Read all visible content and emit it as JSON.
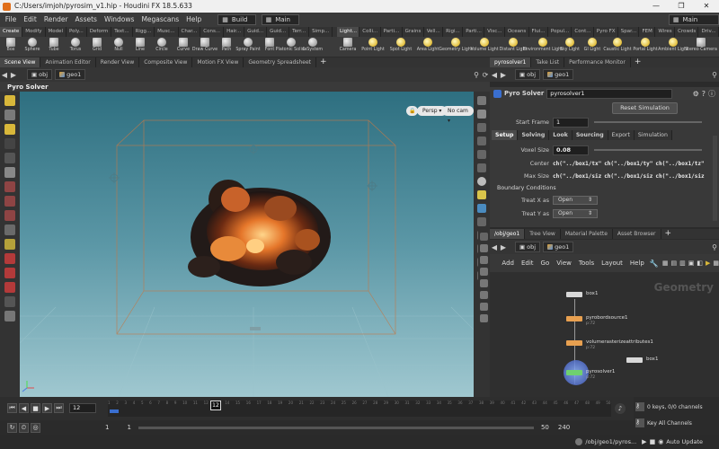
{
  "window": {
    "title": "C:/Users/imjoh/pyrosim_v1.hip - Houdini FX 18.5.633",
    "minimize": "—",
    "maximize": "❐",
    "close": "✕"
  },
  "menu": [
    "File",
    "Edit",
    "Render",
    "Assets",
    "Windows",
    "Megascans",
    "Help"
  ],
  "desktops": {
    "build": "Build",
    "main_left": "Main",
    "main_right": "Main"
  },
  "shelf_tabs_left": [
    "Create",
    "Modify",
    "Model",
    "Poly...",
    "Deform",
    "Text...",
    "Rigg...",
    "Musc...",
    "Char...",
    "Cons...",
    "Hair...",
    "Guid...",
    "Guid...",
    "Terr...",
    "Simp..."
  ],
  "shelf_tabs_right": [
    "Light...",
    "Colli...",
    "Parti...",
    "Grains",
    "Vell...",
    "Rigi...",
    "Parti...",
    "Visc...",
    "Oceans",
    "Flui...",
    "Popul...",
    "Cont...",
    "Pyro FX",
    "Spar...",
    "FEM",
    "Wires",
    "Crowds",
    "Driv..."
  ],
  "shelf_tools_left": [
    "Box",
    "Sphere",
    "Tube",
    "Torus",
    "Grid",
    "Null",
    "Line",
    "Circle",
    "Curve",
    "Draw Curve",
    "Path",
    "Spray Paint",
    "Font",
    "Platonic Solids",
    "L-System"
  ],
  "shelf_tools_right": [
    "Camera",
    "Point Light",
    "Spot Light",
    "Area Light",
    "Geometry Light",
    "Volume Light",
    "Distant Light",
    "Environment Light",
    "Sky Light",
    "GI Light",
    "Caustic Light",
    "Portal Light",
    "Ambient Light",
    "Stereo Camera"
  ],
  "pane_tabs_left": [
    "Scene View",
    "Animation Editor",
    "Render View",
    "Composite View",
    "Motion FX View",
    "Geometry Spreadsheet"
  ],
  "pane_tabs_right": [
    "pyrosolver1",
    "Take List",
    "Performance Monitor"
  ],
  "path": {
    "obj": "obj",
    "geo": "geo1"
  },
  "viewport": {
    "title": "Pyro Solver",
    "persp": "Persp ▾",
    "cam": "No cam ▾"
  },
  "params": {
    "node_type": "Pyro Solver",
    "node_name": "pyrosolver1",
    "reset_button": "Reset Simulation",
    "start_frame_label": "Start Frame",
    "start_frame": "1",
    "tabs": [
      "Setup",
      "Solving",
      "Look",
      "Sourcing",
      "Export",
      "Simulation"
    ],
    "voxel_size_label": "Voxel Size",
    "voxel_size": "0.08",
    "center_label": "Center",
    "center_values": [
      "ch(\"../box1/tx\"",
      "ch(\"../box1/ty\"",
      "ch(\"../box1/tz\""
    ],
    "max_size_label": "Max Size",
    "max_size_values": [
      "ch(\"../box1/siz",
      "ch(\"../box1/siz",
      "ch(\"../box1/siz"
    ],
    "boundary_heading": "Boundary Conditions",
    "treat_x_label": "Treat X as",
    "treat_x": "Open",
    "treat_y_label": "Treat Y as",
    "treat_y": "Open"
  },
  "network": {
    "tabs": [
      "/obj/geo1",
      "Tree View",
      "Material Palette",
      "Asset Browser"
    ],
    "menu": [
      "Add",
      "Edit",
      "Go",
      "View",
      "Tools",
      "Layout",
      "Help"
    ],
    "context_label": "Geometry",
    "nodes": [
      {
        "name": "box1",
        "sub": ""
      },
      {
        "name": "pyrobordsource1",
        "sub": "p:72"
      },
      {
        "name": "volumerasterizeattributes1",
        "sub": "p:72"
      },
      {
        "name": "pyrosolver1",
        "sub": "p:72"
      },
      {
        "name": "box1",
        "sub": ""
      }
    ]
  },
  "timeline": {
    "current_frame": "12",
    "ticks": [
      "1",
      "2",
      "3",
      "4",
      "5",
      "6",
      "7",
      "8",
      "9",
      "10",
      "11",
      "12",
      "13",
      "14",
      "15",
      "16",
      "17",
      "18",
      "19",
      "20",
      "21",
      "22",
      "23",
      "24",
      "25",
      "26",
      "27",
      "28",
      "29",
      "30",
      "31",
      "32",
      "33",
      "34",
      "35",
      "36",
      "37",
      "38",
      "39",
      "40",
      "41",
      "42",
      "43",
      "44",
      "45",
      "46",
      "47",
      "48",
      "49",
      "50"
    ],
    "playhead_label": "12",
    "range_start": "1",
    "range_start2": "1",
    "range_end": "50",
    "range_end2": "240",
    "keys_info": "0 keys, 0/0 channels",
    "key_all": "Key All Channels"
  },
  "status": {
    "path": "/obj/geo1/pyros...",
    "auto_update": "Auto Update"
  }
}
